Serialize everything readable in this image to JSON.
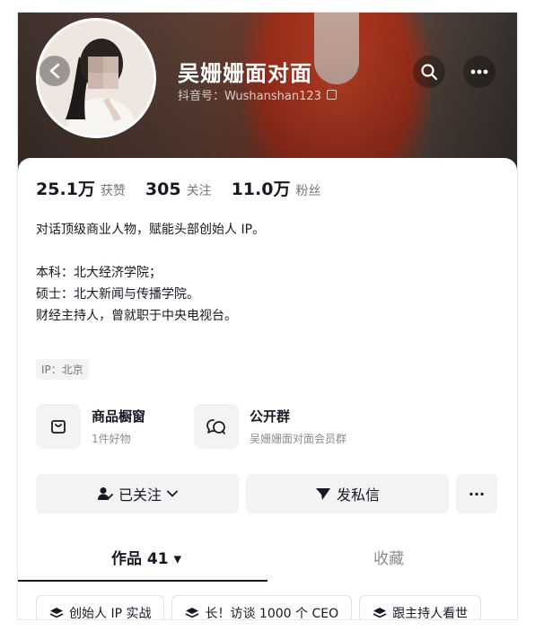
{
  "profile": {
    "name": "吴姗姗面对面",
    "douyin_id": "抖音号：Wushanshan123"
  },
  "stats": [
    {
      "num": "25.1万",
      "label": "获赞"
    },
    {
      "num": "305",
      "label": "关注"
    },
    {
      "num": "11.0万",
      "label": "粉丝"
    }
  ],
  "bio": [
    "对话顶级商业人物，赋能头部创始人 IP。",
    "",
    "本科：北大经济学院；",
    "硕士：北大新闻与传播学院。",
    "财经主持人，曾就职于中央电视台。"
  ],
  "ip_tag": "IP：北京",
  "features": {
    "shop": {
      "title": "商品橱窗",
      "sub": "1件好物"
    },
    "group": {
      "title": "公开群",
      "sub": "吴姗姗面对面会员群"
    }
  },
  "actions": {
    "follow_label": "已关注",
    "message_label": "发私信",
    "more_label": "···"
  },
  "tabs": {
    "works": "作品 41 ▾",
    "favorites": "收藏"
  },
  "collections": [
    "创始人 IP 实战",
    "长！访谈 1000 个 CEO",
    "跟主持人看世"
  ],
  "icons": [
    "back-arrow-icon",
    "search-icon",
    "more-icon",
    "copy-icon",
    "shop-bag-icon",
    "chat-icon",
    "follow-person-icon",
    "chevron-down-icon",
    "send-icon",
    "stack-icon"
  ]
}
